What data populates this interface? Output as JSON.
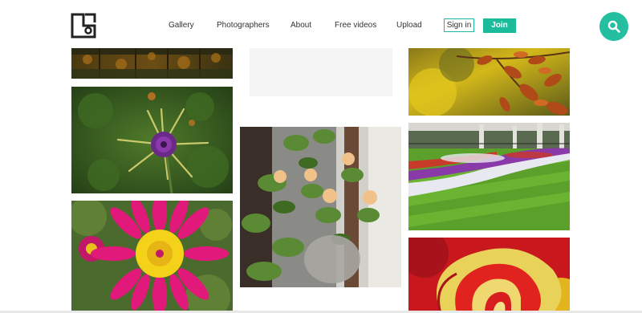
{
  "header": {
    "logo_icon": "site-logo-icon",
    "nav": [
      {
        "label": "Gallery"
      },
      {
        "label": "Photographers"
      },
      {
        "label": "About"
      },
      {
        "label": "Free videos"
      },
      {
        "label": "Upload"
      }
    ],
    "signin_label": "Sign in",
    "join_label": "Join",
    "search_icon": "search-icon"
  },
  "colors": {
    "accent": "#1bbc9b",
    "search_bg": "#23bfa0"
  },
  "gallery": {
    "photos": [
      {
        "subject": "autumn-forest"
      },
      {
        "subject": "purple-star-flower"
      },
      {
        "subject": "pink-daisy"
      },
      {
        "subject": "blank-placeholder"
      },
      {
        "subject": "roses-in-window"
      },
      {
        "subject": "autumn-leaves"
      },
      {
        "subject": "palace-garden-lawn"
      },
      {
        "subject": "red-yellow-rose"
      }
    ]
  }
}
